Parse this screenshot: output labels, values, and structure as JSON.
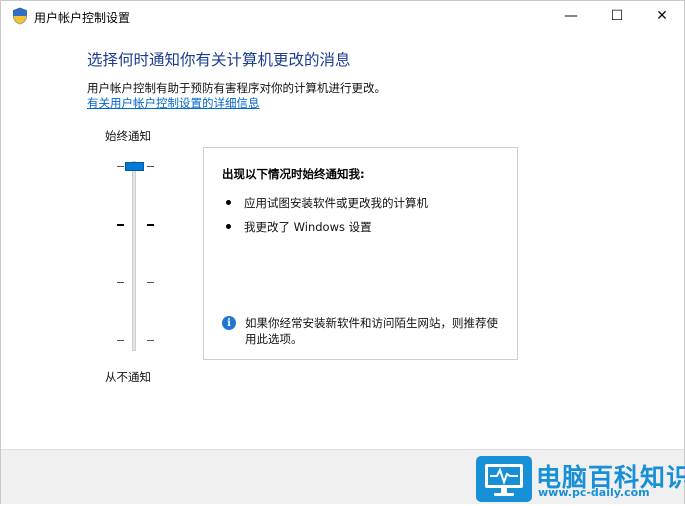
{
  "window": {
    "title": "用户帐户控制设置",
    "controls": {
      "minimize": "—",
      "maximize": "☐",
      "close": "✕"
    }
  },
  "heading": "选择何时通知你有关计算机更改的消息",
  "description": "用户帐户控制有助于预防有害程序对你的计算机进行更改。",
  "more_info_link": "有关用户帐户控制设置的详细信息",
  "slider": {
    "top_label": "始终通知",
    "bottom_label": "从不通知",
    "levels": 4,
    "selected_level": 4
  },
  "panel": {
    "title": "出现以下情况时始终通知我:",
    "bullets": [
      "应用试图安装软件或更改我的计算机",
      "我更改了 Windows 设置"
    ],
    "info_text": "如果你经常安装新软件和访问陌生网站，则推荐使用此选项。"
  },
  "watermark": {
    "title": "电脑百科知识",
    "url": "www.pc-daily.com"
  },
  "colors": {
    "heading": "#1b3d8f",
    "link": "#0066cc",
    "slider_thumb": "#0078d7",
    "watermark": "#1790d8"
  }
}
